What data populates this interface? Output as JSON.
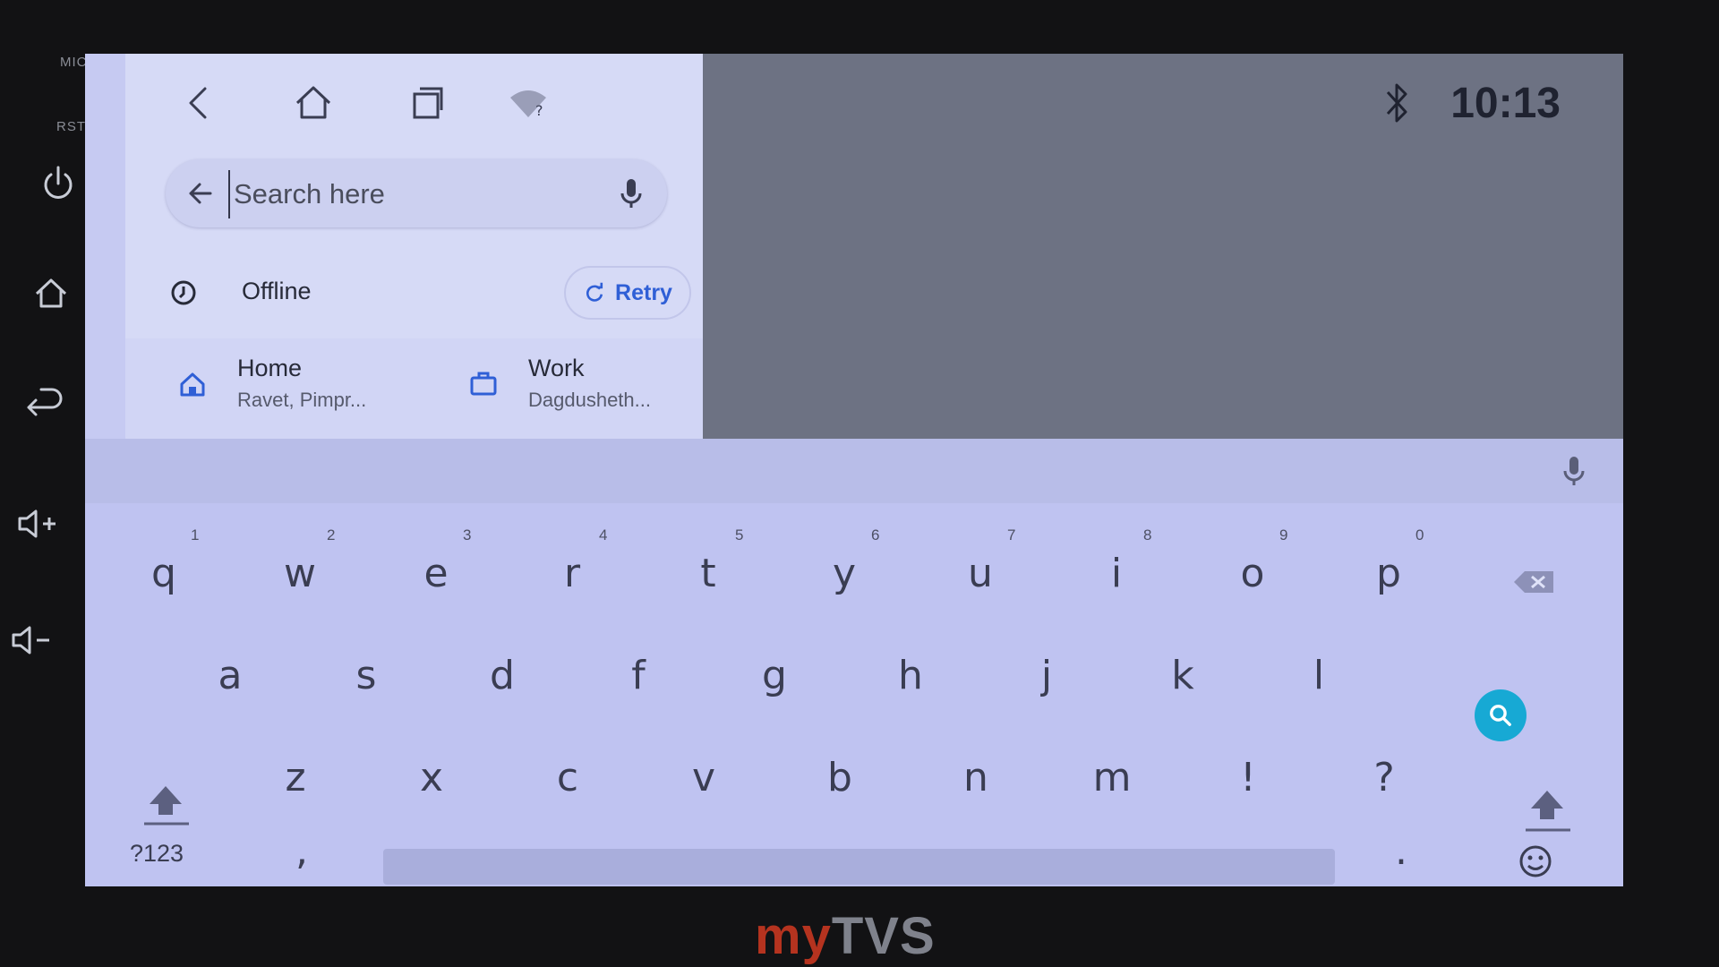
{
  "bezel": {
    "mic_label": "MIC",
    "rst_label": "RST",
    "buttons": [
      "power-icon",
      "home-icon",
      "back-icon",
      "volume-up-icon",
      "volume-down-icon"
    ]
  },
  "status_bar": {
    "time": "10:13",
    "bluetooth_icon": "bluetooth-icon"
  },
  "nav_bar": {
    "icons": [
      "back-icon",
      "home-icon",
      "recents-icon",
      "wifi-unknown-icon"
    ]
  },
  "maps": {
    "search": {
      "placeholder": "Search here"
    },
    "offline": {
      "label": "Offline",
      "retry_label": "Retry"
    },
    "shortcuts": [
      {
        "name": "Home",
        "address": "Ravet, Pimpr...",
        "icon": "home-icon"
      },
      {
        "name": "Work",
        "address": "Dagdusheth...",
        "icon": "briefcase-icon"
      }
    ]
  },
  "keyboard": {
    "row1": [
      "q",
      "w",
      "e",
      "r",
      "t",
      "y",
      "u",
      "i",
      "o",
      "p"
    ],
    "row1_hints": [
      "1",
      "2",
      "3",
      "4",
      "5",
      "6",
      "7",
      "8",
      "9",
      "0"
    ],
    "row2": [
      "a",
      "s",
      "d",
      "f",
      "g",
      "h",
      "j",
      "k",
      "l"
    ],
    "row3": [
      "z",
      "x",
      "c",
      "v",
      "b",
      "n",
      "m",
      "!",
      "?"
    ],
    "symbols_label": "?123",
    "comma": ",",
    "period": ".",
    "accent_color": "#17a9d4"
  },
  "brand": {
    "logo_my": "my",
    "logo_tvs": "TVS",
    "my_color": "#b5331f",
    "tvs_color": "#7f828c"
  }
}
